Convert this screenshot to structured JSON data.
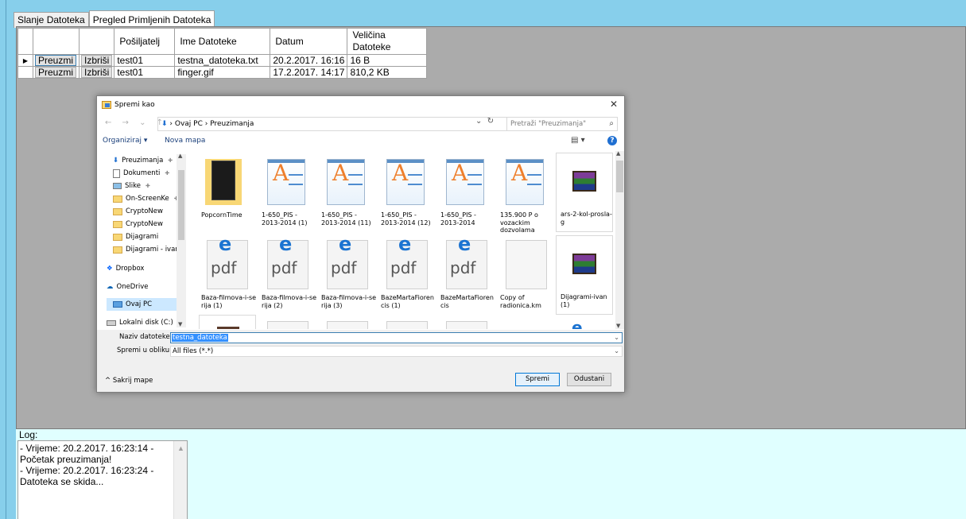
{
  "tabs": [
    "Slanje Datoteka",
    "Pregled Primljenih Datoteka"
  ],
  "grid": {
    "columns": [
      "",
      "",
      "Pošiljatelj",
      "Ime Datoteke",
      "Datum",
      "Veličina\nDatoteke"
    ],
    "rows": [
      {
        "download": "Preuzmi",
        "delete": "Izbriši",
        "sender": "test01",
        "file": "testna_datoteka.txt",
        "date": "20.2.2017. 16:16",
        "size": "16 B"
      },
      {
        "download": "Preuzmi",
        "delete": "Izbriši",
        "sender": "test01",
        "file": "finger.gif",
        "date": "17.2.2017. 14:17",
        "size": "810,2 KB"
      }
    ]
  },
  "log": {
    "label": "Log:",
    "lines": [
      "- Vrijeme: 20.2.2017. 16:23:14 -",
      "Početak preuzimanja!",
      "- Vrijeme: 20.2.2017. 16:23:24 -",
      "Datoteka se skida..."
    ]
  },
  "dialog": {
    "title": "Spremi kao",
    "address": "› Ovaj PC › Preuzimanja",
    "search_placeholder": "Pretraži \"Preuzimanja\"",
    "organize": "Organiziraj ▾",
    "new_folder": "Nova mapa",
    "nav_items": [
      "Preuzimanja",
      "Dokumenti",
      "Slike",
      "On-ScreenKe",
      "CryptoNew",
      "CryptoNew",
      "Dijagrami",
      "Dijagrami - ivan",
      "Dropbox",
      "OneDrive",
      "Ovaj PC",
      "Lokalni disk (C:)"
    ],
    "files": [
      {
        "name": "PopcornTime",
        "icon": "folder"
      },
      {
        "name": "1-650_PIS -\n2013-2014 (1)",
        "icon": "wordpad"
      },
      {
        "name": "1-650_PIS -\n2013-2014 (11)",
        "icon": "wordpad"
      },
      {
        "name": "1-650_PIS -\n2013-2014 (12)",
        "icon": "wordpad"
      },
      {
        "name": "1-650_PIS -\n2013-2014",
        "icon": "wordpad"
      },
      {
        "name": "135.900 P o\nvozackim\ndozvolama",
        "icon": "wordpad"
      },
      {
        "name": "ars-2-kol-prosla-\ng",
        "icon": "rar"
      },
      {
        "name": "Baza-filmova-i-se\nrija (1)",
        "icon": "pdf"
      },
      {
        "name": "Baza-filmova-i-se\nrija (2)",
        "icon": "pdf"
      },
      {
        "name": "Baza-filmova-i-se\nrija (3)",
        "icon": "pdf"
      },
      {
        "name": "BazeMartaFioren\ncis (1)",
        "icon": "pdf"
      },
      {
        "name": "BazeMartaFioren\ncis",
        "icon": "pdf"
      },
      {
        "name": "Copy of\nradionica.km",
        "icon": "blank"
      },
      {
        "name": "Dijagrami-ivan\n(1)",
        "icon": "rar"
      }
    ],
    "filename_label": "Naziv datoteke:",
    "filename_value": "testna_datoteka",
    "type_label": "Spremi u obliku:",
    "type_value": "All files (*.*)",
    "hide_folders": "^ Sakrij mape",
    "save": "Spremi",
    "cancel": "Odustani"
  }
}
